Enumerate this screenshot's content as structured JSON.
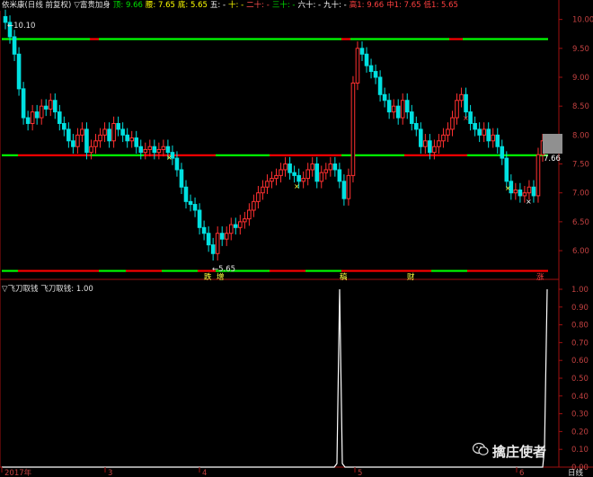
{
  "header": {
    "stock": "依米康(日线 前复权)",
    "indicator": "▽富贵加身",
    "items": [
      {
        "label": "顶",
        "value": "9.66",
        "color": "#00e000"
      },
      {
        "label": "腰",
        "value": "7.65",
        "color": "#ffff00"
      },
      {
        "label": "底",
        "value": "5.65",
        "color": "#ffff00"
      },
      {
        "label": "五",
        "value": "-",
        "color": "#ffffff"
      },
      {
        "label": "十",
        "value": "-",
        "color": "#ffff00"
      },
      {
        "label": "二十",
        "value": "-",
        "color": "#ff5050"
      },
      {
        "label": "三十",
        "value": "-",
        "color": "#00e000"
      },
      {
        "label": "六十",
        "value": "-",
        "color": "#ffffff"
      },
      {
        "label": "九十",
        "value": "-",
        "color": "#ffffff"
      },
      {
        "label": "高1",
        "value": "9.66",
        "color": "#ff4040"
      },
      {
        "label": "中1",
        "value": "7.65",
        "color": "#ff4040"
      },
      {
        "label": "低1",
        "value": "5.65",
        "color": "#ff4040"
      }
    ]
  },
  "sub_header": {
    "indicator": "▽飞刀取钱",
    "label": "飞刀取钱",
    "value": "1.00"
  },
  "price_axis": [
    "10.00",
    "9.50",
    "9.00",
    "8.50",
    "8.00",
    "7.50",
    "7.00",
    "6.50",
    "6.00"
  ],
  "sub_axis": [
    "1.00",
    "0.90",
    "0.80",
    "0.70",
    "0.60",
    "0.50",
    "0.40",
    "0.30",
    "0.20",
    "0.10",
    "0.00"
  ],
  "date_axis": [
    "2017年",
    "3",
    "4",
    "5",
    "6"
  ],
  "period_label": "日线",
  "annotations": {
    "high": "10.10",
    "low": "5.65",
    "current": "7.66",
    "markers": [
      "跌",
      "增",
      "稿",
      "财",
      "涨"
    ]
  },
  "levels": {
    "top": 9.66,
    "mid": 7.65,
    "bottom": 5.65
  },
  "colors": {
    "up": "#ff3030",
    "down": "#00e0e0",
    "level_green": "#00ff00",
    "level_red": "#ff0000",
    "signal": "#ffffff"
  },
  "watermark": "擒庄使者",
  "chart_data": {
    "type": "candlestick",
    "ylim": [
      5.55,
      10.15
    ],
    "closes": [
      9.95,
      9.7,
      9.4,
      8.8,
      8.3,
      8.2,
      8.4,
      8.3,
      8.5,
      8.45,
      8.6,
      8.4,
      8.2,
      8.1,
      7.9,
      7.8,
      8.0,
      8.1,
      7.7,
      7.8,
      7.9,
      8.0,
      8.1,
      7.9,
      8.2,
      8.1,
      8.0,
      7.9,
      7.95,
      7.8,
      7.7,
      7.75,
      7.8,
      7.7,
      7.75,
      7.8,
      7.7,
      7.6,
      7.4,
      7.1,
      6.85,
      6.8,
      6.7,
      6.4,
      6.3,
      6.1,
      5.95,
      6.3,
      6.2,
      6.3,
      6.45,
      6.4,
      6.5,
      6.55,
      6.7,
      6.85,
      7.0,
      7.1,
      7.2,
      7.25,
      7.3,
      7.4,
      7.5,
      7.35,
      7.3,
      7.2,
      7.25,
      7.4,
      7.5,
      7.2,
      7.35,
      7.4,
      7.5,
      7.4,
      7.2,
      6.9,
      7.3,
      8.9,
      9.5,
      9.4,
      9.2,
      9.1,
      9.0,
      8.7,
      8.6,
      8.4,
      8.5,
      8.3,
      8.6,
      8.4,
      8.2,
      8.1,
      7.8,
      7.9,
      7.7,
      7.8,
      7.9,
      8.0,
      8.1,
      8.3,
      8.6,
      8.7,
      8.4,
      8.2,
      8.1,
      8.0,
      8.1,
      7.9,
      8.0,
      7.8,
      7.6,
      7.2,
      7.0,
      7.05,
      6.95,
      7.0,
      7.1,
      6.95,
      7.66,
      7.9
    ]
  }
}
